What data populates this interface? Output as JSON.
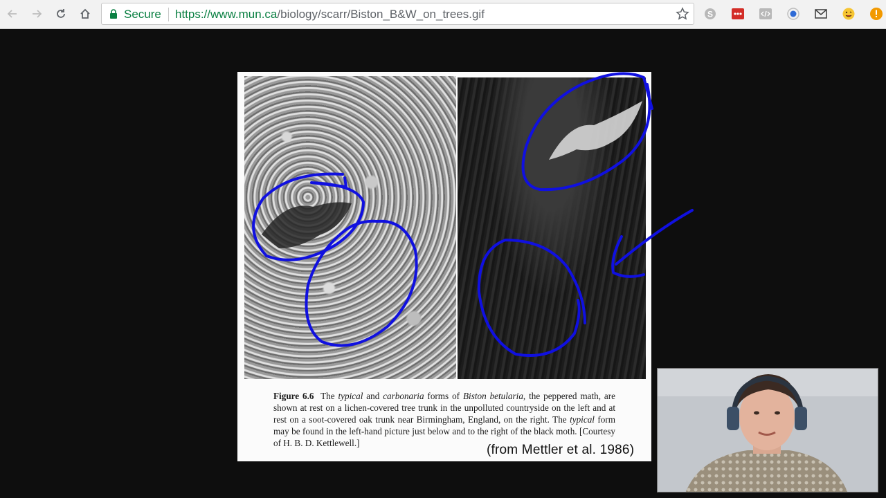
{
  "browser": {
    "security_label": "Secure",
    "url_host": "https://www.mun.ca",
    "url_path": "/biology/scarr/Biston_B&W_on_trees.gif",
    "extensions": [
      "skype-icon",
      "lastpass-icon",
      "devtools-icon",
      "hangouts-icon",
      "gmail-icon",
      "emoji-icon",
      "warning-icon"
    ]
  },
  "figure": {
    "caption_label": "Figure 6.6",
    "caption_parts": [
      "The ",
      "typical",
      " and ",
      "carbonaria",
      " forms of ",
      "Biston betularia",
      ", the peppered math, are shown at rest on a lichen-covered tree trunk in the unpolluted countryside on the left and at rest on a soot-covered oak trunk near Birmingham, England, on the right. The ",
      "typical",
      " form may be found in the left-hand picture just below and to the right of the black moth. [Courtesy of H. B. D. Kettlewell.]"
    ],
    "credit": "(from Mettler et al. 1986)"
  },
  "colors": {
    "annotation": "#1010e0",
    "secure_green": "#0b8043",
    "page_background": "#0e0e0e"
  }
}
